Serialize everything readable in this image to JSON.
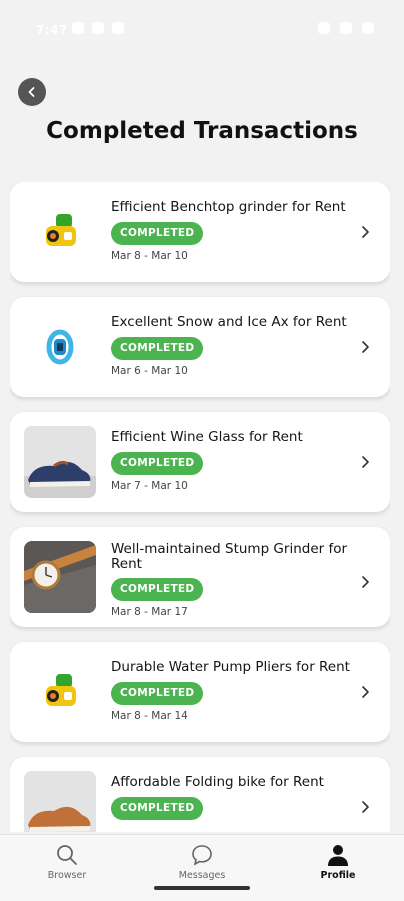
{
  "status_bar": {
    "time": "7:47"
  },
  "header": {
    "title": "Completed Transactions"
  },
  "transactions": [
    {
      "title": "Efficient Benchtop grinder for Rent",
      "status": "COMPLETED",
      "dates": "Mar 8 - Mar 10",
      "image_icon": "yellow-green-toy-icon"
    },
    {
      "title": "Excellent Snow and Ice Ax for Rent",
      "status": "COMPLETED",
      "dates": "Mar 6 - Mar 10",
      "image_icon": "blue-fitness-band-icon"
    },
    {
      "title": "Efficient Wine Glass for Rent",
      "status": "COMPLETED",
      "dates": "Mar 7 - Mar 10",
      "image_icon": "sneaker-photo"
    },
    {
      "title": "Well-maintained Stump Grinder for Rent",
      "status": "COMPLETED",
      "dates": "Mar 8 - Mar 17",
      "image_icon": "wristwatch-photo"
    },
    {
      "title": "Durable Water Pump Pliers for Rent",
      "status": "COMPLETED",
      "dates": "Mar 8 - Mar 14",
      "image_icon": "yellow-green-toy-icon"
    },
    {
      "title": "Affordable Folding bike for Rent",
      "status": "COMPLETED",
      "dates": "",
      "image_icon": "sneaker-photo"
    }
  ],
  "bottom_nav": {
    "items": [
      {
        "label": "Browser",
        "icon": "search-icon",
        "active": false
      },
      {
        "label": "Messages",
        "icon": "chat-bubble-icon",
        "active": false
      },
      {
        "label": "Profile",
        "icon": "person-icon",
        "active": true
      }
    ]
  },
  "colors": {
    "completed_badge": "#4bb34f",
    "background": "#f2f2f2"
  }
}
